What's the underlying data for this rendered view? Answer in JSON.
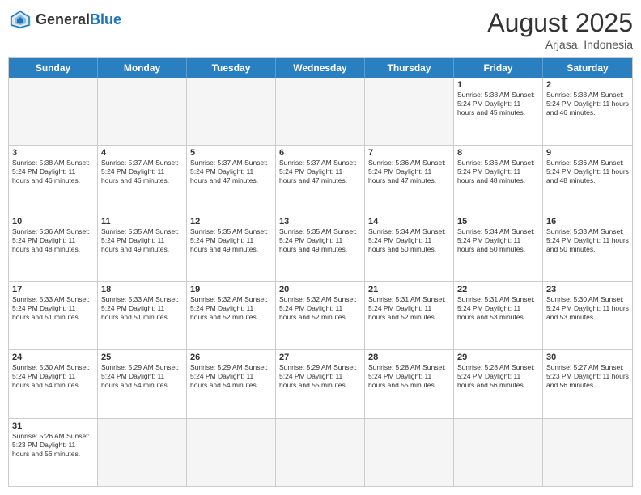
{
  "header": {
    "logo_general": "General",
    "logo_blue": "Blue",
    "title": "August 2025",
    "location": "Arjasa, Indonesia"
  },
  "days_of_week": [
    "Sunday",
    "Monday",
    "Tuesday",
    "Wednesday",
    "Thursday",
    "Friday",
    "Saturday"
  ],
  "weeks": [
    [
      {
        "day": "",
        "info": ""
      },
      {
        "day": "",
        "info": ""
      },
      {
        "day": "",
        "info": ""
      },
      {
        "day": "",
        "info": ""
      },
      {
        "day": "",
        "info": ""
      },
      {
        "day": "1",
        "info": "Sunrise: 5:38 AM\nSunset: 5:24 PM\nDaylight: 11 hours\nand 45 minutes."
      },
      {
        "day": "2",
        "info": "Sunrise: 5:38 AM\nSunset: 5:24 PM\nDaylight: 11 hours\nand 46 minutes."
      }
    ],
    [
      {
        "day": "3",
        "info": "Sunrise: 5:38 AM\nSunset: 5:24 PM\nDaylight: 11 hours\nand 46 minutes."
      },
      {
        "day": "4",
        "info": "Sunrise: 5:37 AM\nSunset: 5:24 PM\nDaylight: 11 hours\nand 46 minutes."
      },
      {
        "day": "5",
        "info": "Sunrise: 5:37 AM\nSunset: 5:24 PM\nDaylight: 11 hours\nand 47 minutes."
      },
      {
        "day": "6",
        "info": "Sunrise: 5:37 AM\nSunset: 5:24 PM\nDaylight: 11 hours\nand 47 minutes."
      },
      {
        "day": "7",
        "info": "Sunrise: 5:36 AM\nSunset: 5:24 PM\nDaylight: 11 hours\nand 47 minutes."
      },
      {
        "day": "8",
        "info": "Sunrise: 5:36 AM\nSunset: 5:24 PM\nDaylight: 11 hours\nand 48 minutes."
      },
      {
        "day": "9",
        "info": "Sunrise: 5:36 AM\nSunset: 5:24 PM\nDaylight: 11 hours\nand 48 minutes."
      }
    ],
    [
      {
        "day": "10",
        "info": "Sunrise: 5:36 AM\nSunset: 5:24 PM\nDaylight: 11 hours\nand 48 minutes."
      },
      {
        "day": "11",
        "info": "Sunrise: 5:35 AM\nSunset: 5:24 PM\nDaylight: 11 hours\nand 49 minutes."
      },
      {
        "day": "12",
        "info": "Sunrise: 5:35 AM\nSunset: 5:24 PM\nDaylight: 11 hours\nand 49 minutes."
      },
      {
        "day": "13",
        "info": "Sunrise: 5:35 AM\nSunset: 5:24 PM\nDaylight: 11 hours\nand 49 minutes."
      },
      {
        "day": "14",
        "info": "Sunrise: 5:34 AM\nSunset: 5:24 PM\nDaylight: 11 hours\nand 50 minutes."
      },
      {
        "day": "15",
        "info": "Sunrise: 5:34 AM\nSunset: 5:24 PM\nDaylight: 11 hours\nand 50 minutes."
      },
      {
        "day": "16",
        "info": "Sunrise: 5:33 AM\nSunset: 5:24 PM\nDaylight: 11 hours\nand 50 minutes."
      }
    ],
    [
      {
        "day": "17",
        "info": "Sunrise: 5:33 AM\nSunset: 5:24 PM\nDaylight: 11 hours\nand 51 minutes."
      },
      {
        "day": "18",
        "info": "Sunrise: 5:33 AM\nSunset: 5:24 PM\nDaylight: 11 hours\nand 51 minutes."
      },
      {
        "day": "19",
        "info": "Sunrise: 5:32 AM\nSunset: 5:24 PM\nDaylight: 11 hours\nand 52 minutes."
      },
      {
        "day": "20",
        "info": "Sunrise: 5:32 AM\nSunset: 5:24 PM\nDaylight: 11 hours\nand 52 minutes."
      },
      {
        "day": "21",
        "info": "Sunrise: 5:31 AM\nSunset: 5:24 PM\nDaylight: 11 hours\nand 52 minutes."
      },
      {
        "day": "22",
        "info": "Sunrise: 5:31 AM\nSunset: 5:24 PM\nDaylight: 11 hours\nand 53 minutes."
      },
      {
        "day": "23",
        "info": "Sunrise: 5:30 AM\nSunset: 5:24 PM\nDaylight: 11 hours\nand 53 minutes."
      }
    ],
    [
      {
        "day": "24",
        "info": "Sunrise: 5:30 AM\nSunset: 5:24 PM\nDaylight: 11 hours\nand 54 minutes."
      },
      {
        "day": "25",
        "info": "Sunrise: 5:29 AM\nSunset: 5:24 PM\nDaylight: 11 hours\nand 54 minutes."
      },
      {
        "day": "26",
        "info": "Sunrise: 5:29 AM\nSunset: 5:24 PM\nDaylight: 11 hours\nand 54 minutes."
      },
      {
        "day": "27",
        "info": "Sunrise: 5:29 AM\nSunset: 5:24 PM\nDaylight: 11 hours\nand 55 minutes."
      },
      {
        "day": "28",
        "info": "Sunrise: 5:28 AM\nSunset: 5:24 PM\nDaylight: 11 hours\nand 55 minutes."
      },
      {
        "day": "29",
        "info": "Sunrise: 5:28 AM\nSunset: 5:24 PM\nDaylight: 11 hours\nand 56 minutes."
      },
      {
        "day": "30",
        "info": "Sunrise: 5:27 AM\nSunset: 5:23 PM\nDaylight: 11 hours\nand 56 minutes."
      }
    ],
    [
      {
        "day": "31",
        "info": "Sunrise: 5:26 AM\nSunset: 5:23 PM\nDaylight: 11 hours\nand 56 minutes."
      },
      {
        "day": "",
        "info": ""
      },
      {
        "day": "",
        "info": ""
      },
      {
        "day": "",
        "info": ""
      },
      {
        "day": "",
        "info": ""
      },
      {
        "day": "",
        "info": ""
      },
      {
        "day": "",
        "info": ""
      }
    ]
  ]
}
